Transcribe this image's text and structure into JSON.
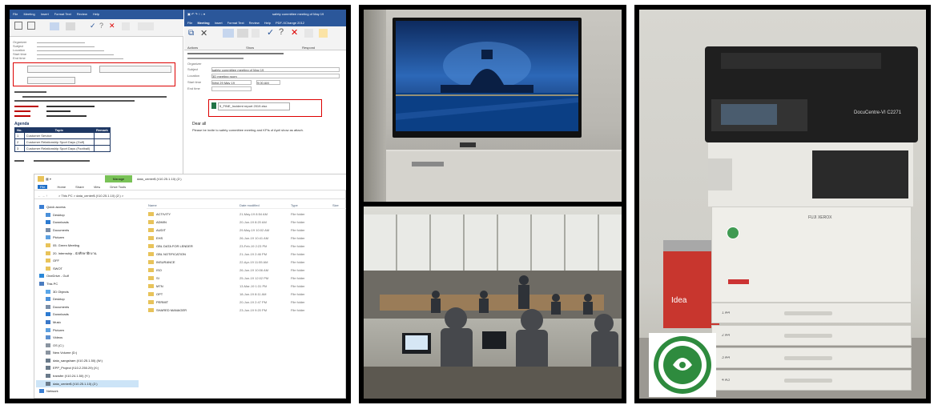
{
  "panels": [
    {
      "kind": "screenshot",
      "name": "outlook-and-explorer"
    },
    {
      "kind": "photo",
      "name": "tv-and-meeting"
    },
    {
      "kind": "photo",
      "name": "copier"
    }
  ],
  "outlook_left": {
    "title_bar": "Meeting",
    "ribbon_tabs": [
      "File",
      "Meeting",
      "Insert",
      "Format Text",
      "Review",
      "Help"
    ],
    "fields": [
      {
        "label": "Organizer",
        "value": ""
      },
      {
        "label": "Subject",
        "value": ""
      },
      {
        "label": "Location",
        "value": ""
      },
      {
        "label": "Start time",
        "value": ""
      },
      {
        "label": "End time",
        "value": ""
      }
    ],
    "agenda_title": "Agenda",
    "agenda_headers": [
      "No.",
      "Topic",
      "Remark"
    ],
    "agenda_rows": [
      {
        "no": "1",
        "topic": "Customer Service",
        "remark": ""
      },
      {
        "no": "2",
        "topic": "Customer Relationship Sport Days (Golf)",
        "remark": ""
      },
      {
        "no": "3",
        "topic": "Customer Relationship Sport Days (Football)",
        "remark": ""
      }
    ]
  },
  "outlook_right": {
    "title": "safety committee meeting of May 19",
    "ribbon_tabs": [
      "File",
      "Meeting",
      "Insert",
      "Format Text",
      "Review",
      "Help",
      "PDF-XChange 2012"
    ],
    "tell_me": "Tell me what you w",
    "ribbon_groups": [
      "Actions",
      "Show",
      "Respond"
    ],
    "ribbon_buttons": [
      "Join & Online",
      "Delete",
      "Appointment",
      "Scheduling Assistant",
      "Tracking",
      "Accept",
      "Tentative",
      "Decline",
      "Propose New Time",
      "Respond"
    ],
    "subject": "safety committee meeting of May 19",
    "location": "3D meeting room",
    "start_time": "Wed 29 May 19",
    "start_clock": "9:00 AM",
    "attachment": "5_FINE_Incident report 2019.xlsx",
    "body_greeting": "Dear all",
    "body_text": "Please be invite to safety committee meeting and KPIs of April show as attach."
  },
  "explorer": {
    "tab_manage": "Manage",
    "window_title": "data_center$ (\\\\10.25.1.10) (Z:)",
    "ribbon_tabs": [
      "File",
      "Home",
      "Share",
      "View",
      "Drive Tools"
    ],
    "address": "> This PC > data_center$ (\\\\10.25.1.10) (Z:) >",
    "nav_items": [
      {
        "label": "Quick access",
        "icon": "star-icon",
        "indent": 0
      },
      {
        "label": "Desktop",
        "icon": "folder-blue-icon",
        "indent": 1
      },
      {
        "label": "Downloads",
        "icon": "download-icon",
        "indent": 1
      },
      {
        "label": "Documents",
        "icon": "doc-icon",
        "indent": 1
      },
      {
        "label": "Pictures",
        "icon": "pictures-icon",
        "indent": 1
      },
      {
        "label": "05. Green Meeting",
        "icon": "folder-icon",
        "indent": 1
      },
      {
        "label": "20. Internship - นักศึกษาฝึกงาน",
        "icon": "folder-icon",
        "indent": 1
      },
      {
        "label": "OFF",
        "icon": "folder-icon",
        "indent": 1
      },
      {
        "label": "SWOT",
        "icon": "folder-icon",
        "indent": 1
      },
      {
        "label": "OneDrive - Gulf",
        "icon": "cloud-icon",
        "indent": 0
      },
      {
        "label": "This PC",
        "icon": "pc-icon",
        "indent": 0
      },
      {
        "label": "3D Objects",
        "icon": "cube-icon",
        "indent": 1
      },
      {
        "label": "Desktop",
        "icon": "folder-blue-icon",
        "indent": 1
      },
      {
        "label": "Documents",
        "icon": "doc-icon",
        "indent": 1
      },
      {
        "label": "Downloads",
        "icon": "download-icon",
        "indent": 1
      },
      {
        "label": "Music",
        "icon": "music-icon",
        "indent": 1
      },
      {
        "label": "Pictures",
        "icon": "pictures-icon",
        "indent": 1
      },
      {
        "label": "Videos",
        "icon": "video-icon",
        "indent": 1
      },
      {
        "label": "OS (C:)",
        "icon": "drive-icon",
        "indent": 1
      },
      {
        "label": "New Volume (D:)",
        "icon": "drive-icon",
        "indent": 1
      },
      {
        "label": "data_sangsham (\\\\10.25.1.50) (W:)",
        "icon": "netdrive-icon",
        "indent": 1
      },
      {
        "label": "EPP_Project (\\\\10.2.250.29) (X:)",
        "icon": "netdrive-icon",
        "indent": 1
      },
      {
        "label": "transfer (\\\\10.24.1.50) (Y:)",
        "icon": "netdrive-icon",
        "indent": 1
      },
      {
        "label": "data_center$ (\\\\10.25.1.10) (Z:)",
        "icon": "netdrive-icon",
        "indent": 1,
        "selected": true
      },
      {
        "label": "Network",
        "icon": "network-icon",
        "indent": 0
      }
    ],
    "columns": [
      "Name",
      "Date modified",
      "Type",
      "Size"
    ],
    "files": [
      {
        "name": "ACTIVITY",
        "date": "21-May-19 8:54 AM",
        "type": "File folder"
      },
      {
        "name": "ADMIN",
        "date": "20-Jun-19 8:20 AM",
        "type": "File folder"
      },
      {
        "name": "AUDIT",
        "date": "29-May-19 10:02 AM",
        "type": "File folder"
      },
      {
        "name": "EHS",
        "date": "26-Jun-19 10:41 AM",
        "type": "File folder"
      },
      {
        "name": "GBL DATA FOR LENDER",
        "date": "23-Feb-19 2:23 PM",
        "type": "File folder"
      },
      {
        "name": "GBL NOTIFICATION",
        "date": "21-Jun-19 2:46 PM",
        "type": "File folder"
      },
      {
        "name": "INSURANCE",
        "date": "22-Apr-19 11:55 AM",
        "type": "File folder"
      },
      {
        "name": "ISO",
        "date": "26-Jun-19 10:06 AM",
        "type": "File folder"
      },
      {
        "name": "SI",
        "date": "25-Jun-19 12:02 PM",
        "type": "File folder"
      },
      {
        "name": "MTN",
        "date": "13-Mar-19 1:31 PM",
        "type": "File folder"
      },
      {
        "name": "OPT",
        "date": "18-Jun-19 8:11 AM",
        "type": "File folder"
      },
      {
        "name": "PERMIT",
        "date": "20-Jun-19 2:47 PM",
        "type": "File folder"
      },
      {
        "name": "SHARED MANAGER",
        "date": "23-Jun-19 9:20 PM",
        "type": "File folder"
      }
    ]
  },
  "copier": {
    "brand": "FUJI XEROX",
    "model": "DocuCentre-VI C2271",
    "tray_labels": [
      "1 A4",
      "2 A4",
      "3 A4",
      "4 A3"
    ],
    "box_brand": "Idea",
    "green_label_text": "GREEN LABEL : THAILAND"
  },
  "colors": {
    "outlook_blue": "#2b579a",
    "explorer_manage": "#79c257",
    "highlight_red": "#dd0000",
    "folder_yellow": "#e8c35a",
    "green_label": "#2e8b3e"
  }
}
